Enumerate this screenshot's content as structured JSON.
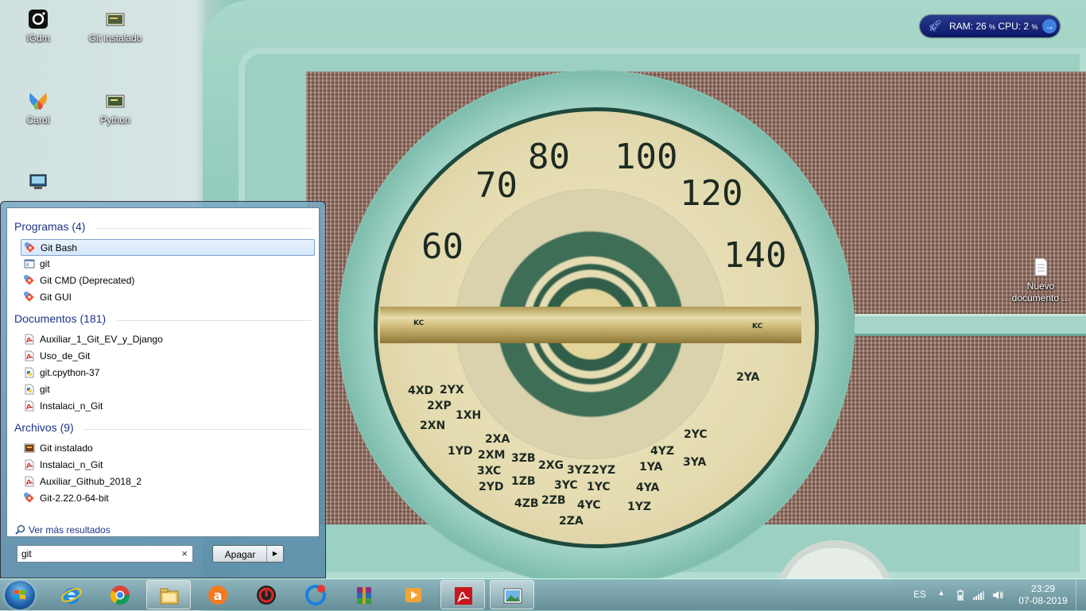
{
  "desktop": {
    "icons": [
      {
        "label": "IGdm",
        "icon": "camera-icon"
      },
      {
        "label": "Git instalado",
        "icon": "image-file-icon"
      },
      {
        "label": "Carol",
        "icon": "msn-butterfly-icon"
      },
      {
        "label": "Python",
        "icon": "image-file-icon"
      },
      {
        "label": "",
        "icon": "program-shortcut-icon"
      },
      {
        "label": "Nuevo documento ...",
        "icon": "text-document-icon"
      }
    ]
  },
  "wallpaper": {
    "dial_numbers": [
      "60",
      "70",
      "80",
      "100",
      "120",
      "140"
    ],
    "dial_labels": [
      "KC",
      "KC",
      "4XD",
      "2YX",
      "2XP",
      "1XH",
      "2XN",
      "2XA",
      "1YD",
      "2XM",
      "3ZB",
      "3XC",
      "2XG",
      "3YZ",
      "2YZ",
      "4YZ",
      "2YC",
      "1YA",
      "3YA",
      "2YD",
      "1ZB",
      "3YC",
      "1YC",
      "4YA",
      "4ZB",
      "2ZB",
      "4YC",
      "1YZ",
      "2ZA",
      "2YA"
    ]
  },
  "gadget": {
    "ram_label": "RAM:",
    "ram_value": "26",
    "cpu_label": "CPU:",
    "cpu_value": "2",
    "unit": "%"
  },
  "start_menu": {
    "groups": [
      {
        "title": "Programas (4)",
        "items": [
          {
            "label": "Git Bash",
            "icon": "git-diamond-icon",
            "selected": true
          },
          {
            "label": "git",
            "icon": "app-window-icon"
          },
          {
            "label": "Git CMD (Deprecated)",
            "icon": "git-diamond-icon"
          },
          {
            "label": "Git GUI",
            "icon": "git-diamond-icon"
          }
        ]
      },
      {
        "title": "Documentos (181)",
        "items": [
          {
            "label": "Auxiliar_1_Git_EV_y_Django",
            "icon": "pdf-icon"
          },
          {
            "label": "Uso_de_Git",
            "icon": "pdf-icon"
          },
          {
            "label": "git.cpython-37",
            "icon": "python-file-icon"
          },
          {
            "label": "git",
            "icon": "python-file-icon"
          },
          {
            "label": "Instalaci_n_Git",
            "icon": "pdf-icon"
          }
        ]
      },
      {
        "title": "Archivos (9)",
        "items": [
          {
            "label": "Git instalado",
            "icon": "image-file-icon"
          },
          {
            "label": "Instalaci_n_Git",
            "icon": "pdf-icon"
          },
          {
            "label": "Auxiliar_Github_2018_2",
            "icon": "pdf-icon"
          },
          {
            "label": "Git-2.22.0-64-bit",
            "icon": "git-diamond-icon"
          }
        ]
      }
    ],
    "see_more": "Ver más resultados",
    "search_value": "git",
    "clear_symbol": "×",
    "shutdown_label": "Apagar"
  },
  "taskbar": {
    "apps": [
      {
        "name": "internet-explorer-icon"
      },
      {
        "name": "chrome-icon"
      },
      {
        "name": "file-explorer-icon",
        "active": true
      },
      {
        "name": "avast-icon"
      },
      {
        "name": "iobit-uninstaller-icon"
      },
      {
        "name": "advanced-systemcare-icon"
      },
      {
        "name": "winrar-icon"
      },
      {
        "name": "media-player-icon"
      },
      {
        "name": "acrobat-reader-icon",
        "active": true
      },
      {
        "name": "image-viewer-icon",
        "active": true
      }
    ],
    "language": "ES",
    "time": "23:29",
    "date": "07-08-2019"
  }
}
